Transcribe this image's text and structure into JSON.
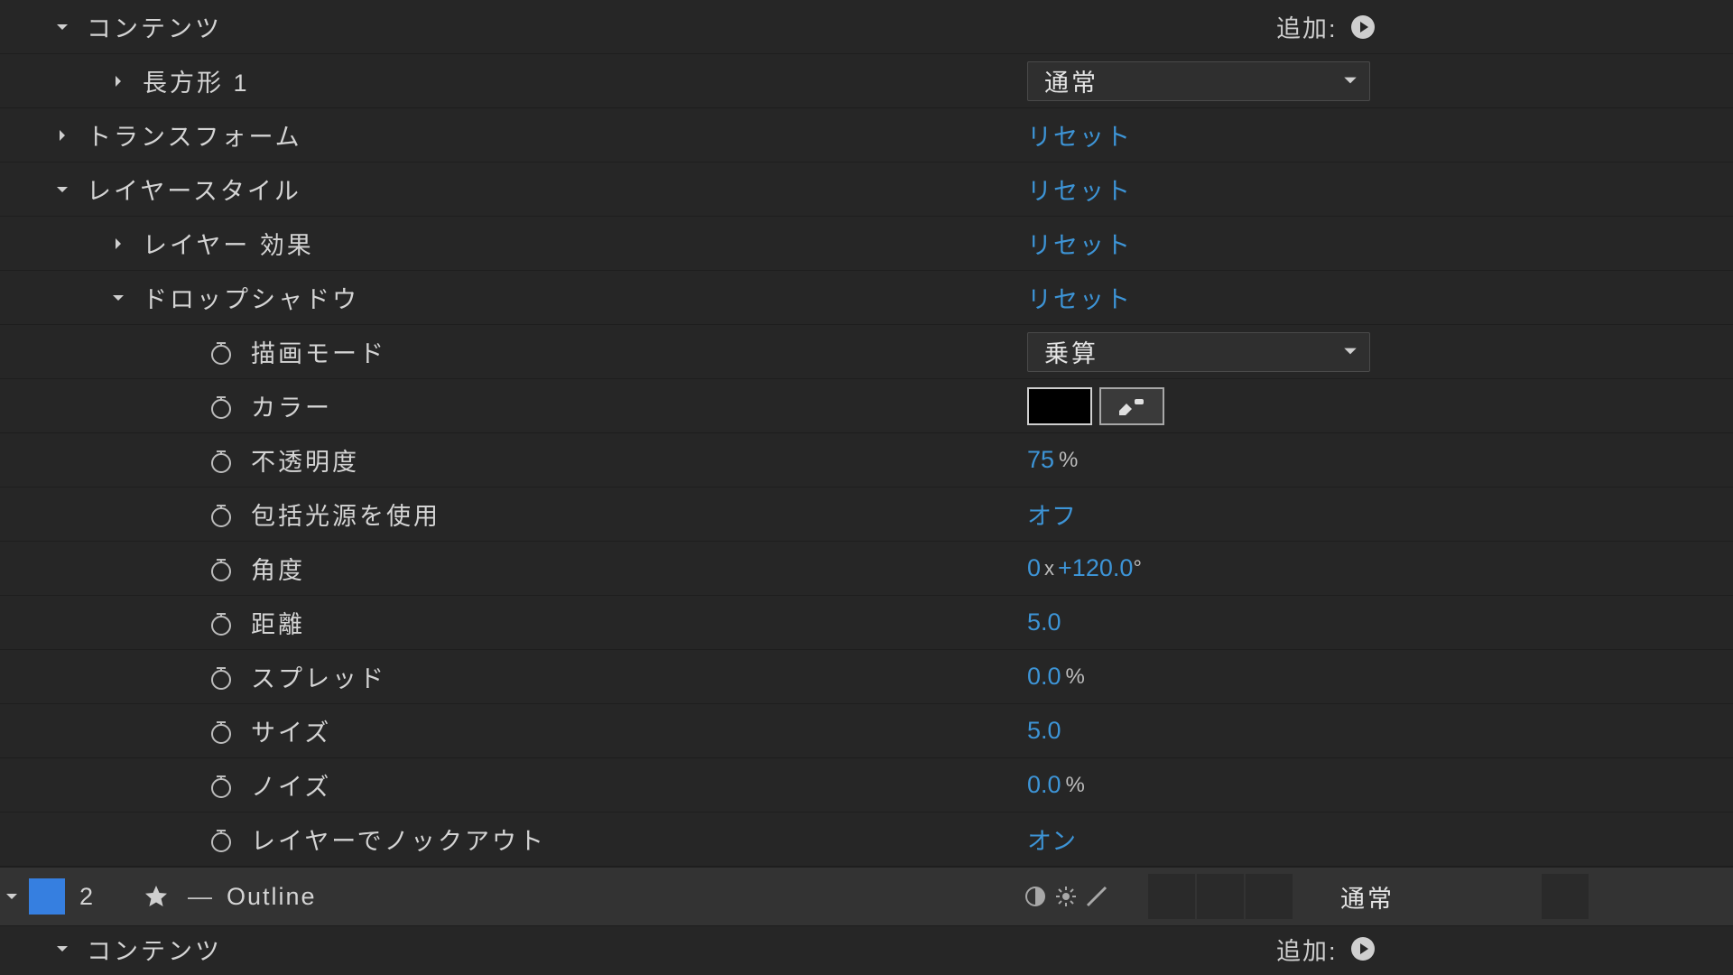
{
  "add_label": "追加:",
  "rows": {
    "contents": "コンテンツ",
    "rect1": "長方形 1",
    "transform": "トランスフォーム",
    "layer_styles": "レイヤースタイル",
    "layer_effects": "レイヤー 効果",
    "drop_shadow": "ドロップシャドウ",
    "reset": "リセット",
    "mode_normal": "通常"
  },
  "props": {
    "blend_mode_label": "描画モード",
    "blend_mode_value": "乗算",
    "color_label": "カラー",
    "opacity_label": "不透明度",
    "opacity_value": "75",
    "opacity_unit": "%",
    "global_light_label": "包括光源を使用",
    "global_light_value": "オフ",
    "angle_label": "角度",
    "angle_val1": "0",
    "angle_x": "x",
    "angle_val2": "+120.0",
    "angle_unit": "°",
    "distance_label": "距離",
    "distance_value": "5.0",
    "spread_label": "スプレッド",
    "spread_value": "0.0",
    "spread_unit": "%",
    "size_label": "サイズ",
    "size_value": "5.0",
    "noise_label": "ノイズ",
    "noise_value": "0.0",
    "noise_unit": "%",
    "knockout_label": "レイヤーでノックアウト",
    "knockout_value": "オン"
  },
  "layer2": {
    "number": "2",
    "dash": "—",
    "name": "Outline",
    "mode": "通常"
  },
  "contents2": "コンテンツ"
}
